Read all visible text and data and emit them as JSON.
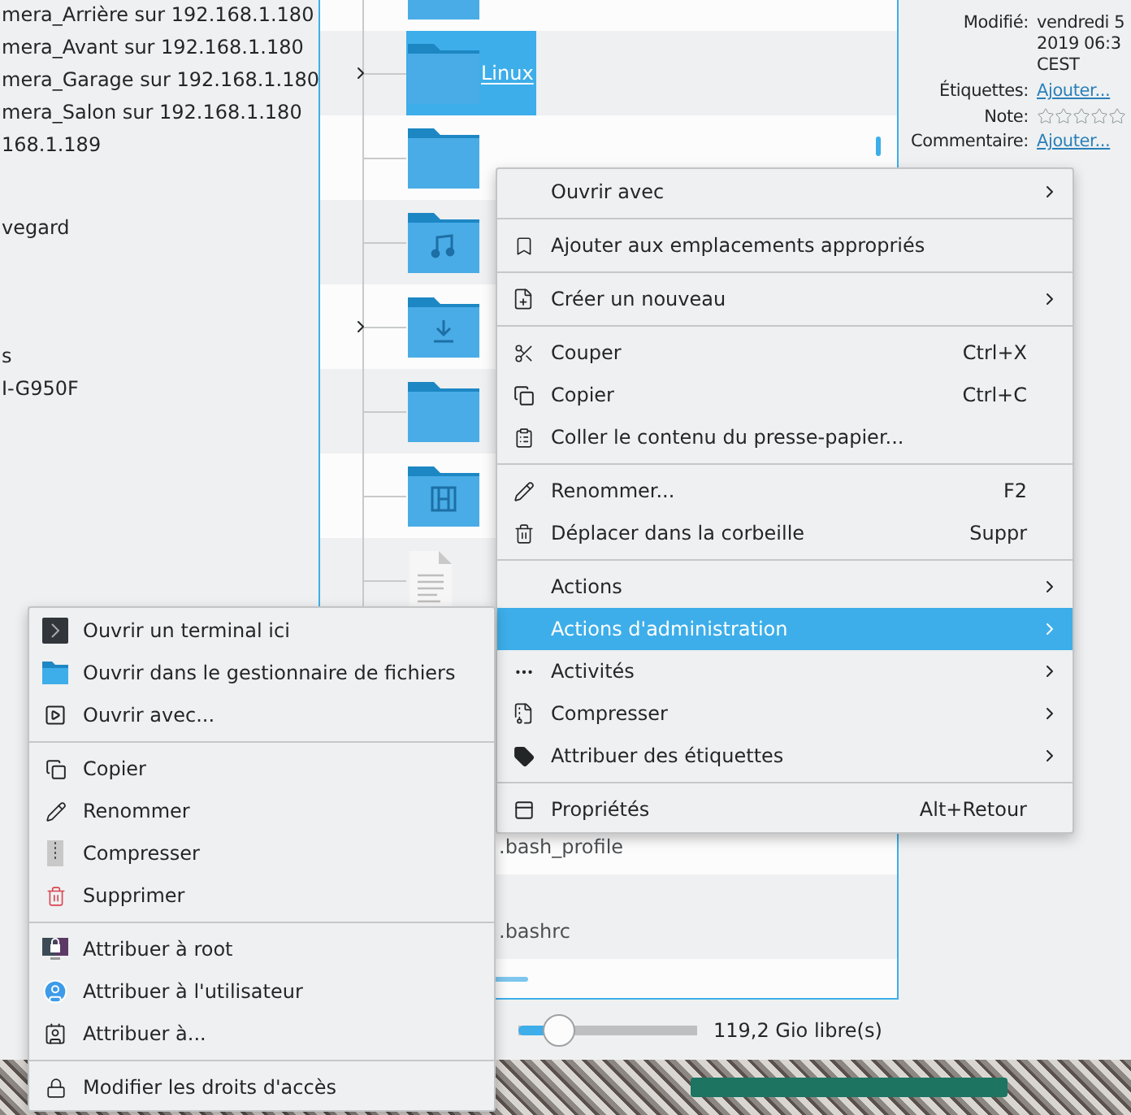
{
  "sidebar": {
    "items": [
      "mera_Arrière sur 192.168.1.180",
      "mera_Avant sur 192.168.1.180",
      "mera_Garage sur 192.168.1.180",
      "mera_Salon sur 192.168.1.180",
      "168.1.189",
      "vegard",
      "s",
      "I-G950F"
    ]
  },
  "files": [
    {
      "kind": "folder",
      "expandable": false,
      "selected": false
    },
    {
      "kind": "folder",
      "name": "Linux",
      "expandable": true,
      "selected": true
    },
    {
      "kind": "folder",
      "expandable": false,
      "selected": false
    },
    {
      "kind": "music",
      "expandable": false,
      "selected": false
    },
    {
      "kind": "download",
      "expandable": true,
      "selected": false
    },
    {
      "kind": "folder",
      "expandable": false,
      "selected": false
    },
    {
      "kind": "video",
      "expandable": false,
      "selected": false
    },
    {
      "kind": "text",
      "expandable": false,
      "selected": false
    }
  ],
  "lower_files": [
    {
      "name": ".bash_profile",
      "selected": false
    },
    {
      "name": ".bashrc",
      "selected": false
    }
  ],
  "info": {
    "fields": [
      {
        "kind": "text",
        "label": "Modifié:",
        "lines": [
          "vendredi 5",
          "2019 06:3",
          "CEST"
        ]
      },
      {
        "kind": "link",
        "label": "Étiquettes:",
        "value": "Ajouter..."
      },
      {
        "kind": "stars",
        "label": "Note:",
        "stars": 0
      },
      {
        "kind": "link",
        "label": "Commentaire:",
        "value": "Ajouter..."
      }
    ]
  },
  "status_bar": {
    "zoom": {
      "level": 0.23
    },
    "free_space": "119,2 Gio libre(s)"
  },
  "context_menu": {
    "groups": [
      [
        {
          "label": "Ouvrir avec",
          "submenu": true,
          "selected": false
        }
      ],
      [
        {
          "label": "Ajouter aux emplacements appropriés",
          "submenu": false,
          "selected": false
        }
      ],
      [
        {
          "label": "Créer un nouveau",
          "submenu": true,
          "selected": false
        }
      ],
      [
        {
          "label": "Couper",
          "shortcut": "Ctrl+X",
          "submenu": false,
          "selected": false
        },
        {
          "label": "Copier",
          "shortcut": "Ctrl+C",
          "submenu": false,
          "selected": false
        },
        {
          "label": "Coller le contenu du presse-papier...",
          "submenu": false,
          "selected": false
        }
      ],
      [
        {
          "label": "Renommer...",
          "shortcut": "F2",
          "submenu": false,
          "selected": false
        },
        {
          "label": "Déplacer dans la corbeille",
          "shortcut": "Suppr",
          "submenu": false,
          "selected": false
        }
      ],
      [
        {
          "label": "Actions",
          "submenu": true,
          "selected": false
        },
        {
          "label": "Actions d'administration",
          "submenu": true,
          "selected": true
        },
        {
          "label": "Activités",
          "submenu": true,
          "selected": false
        },
        {
          "label": "Compresser",
          "submenu": true,
          "selected": false
        },
        {
          "label": "Attribuer des étiquettes",
          "submenu": true,
          "selected": false
        }
      ],
      [
        {
          "label": "Propriétés",
          "shortcut": "Alt+Retour",
          "submenu": false,
          "selected": false
        }
      ]
    ]
  },
  "admin_submenu": {
    "groups": [
      [
        "Ouvrir un terminal ici",
        "Ouvrir dans le gestionnaire de fichiers",
        "Ouvrir avec..."
      ],
      [
        "Copier",
        "Renommer",
        "Compresser",
        "Supprimer"
      ],
      [
        "Attribuer à root",
        "Attribuer à l'utilisateur",
        "Attribuer à..."
      ],
      [
        "Modifier les droits d'accès"
      ]
    ]
  }
}
